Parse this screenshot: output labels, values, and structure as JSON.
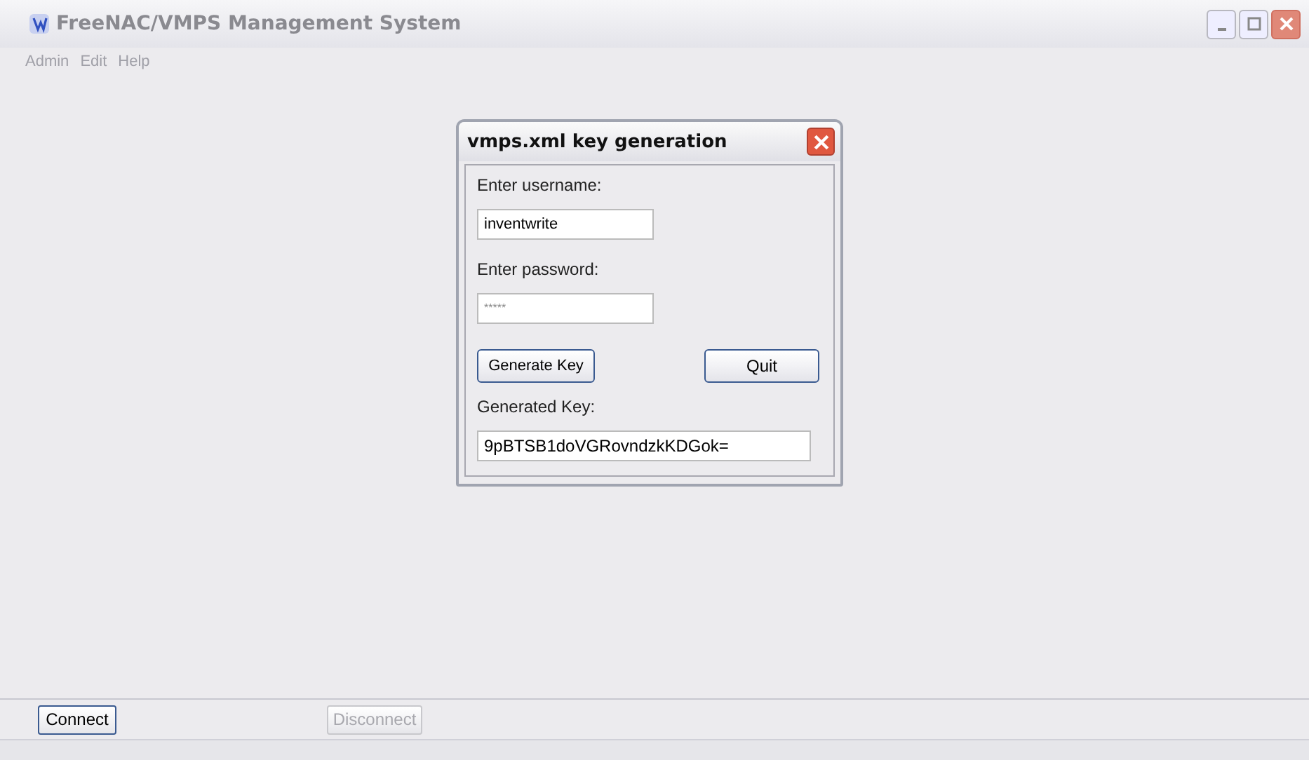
{
  "window": {
    "title": "FreeNAC/VMPS Management System"
  },
  "menu": [
    {
      "label": "Admin",
      "disabled": true
    },
    {
      "label": "Edit",
      "disabled": true
    },
    {
      "label": "Help",
      "disabled": true
    }
  ],
  "dialog": {
    "title": "vmps.xml key generation",
    "username_label": "Enter username:",
    "username": "inventwrite",
    "password_label": "Enter password:",
    "password": "*****",
    "generate_button": "Generate Key",
    "quit_button": "Quit",
    "key_label": "Generated Key:",
    "key": "9pBTSB1doVGRovndzkKDGok="
  },
  "buttons": [
    {
      "label": "Connect",
      "disabled": false
    },
    {
      "label": "Disconnect",
      "disabled": true
    }
  ]
}
